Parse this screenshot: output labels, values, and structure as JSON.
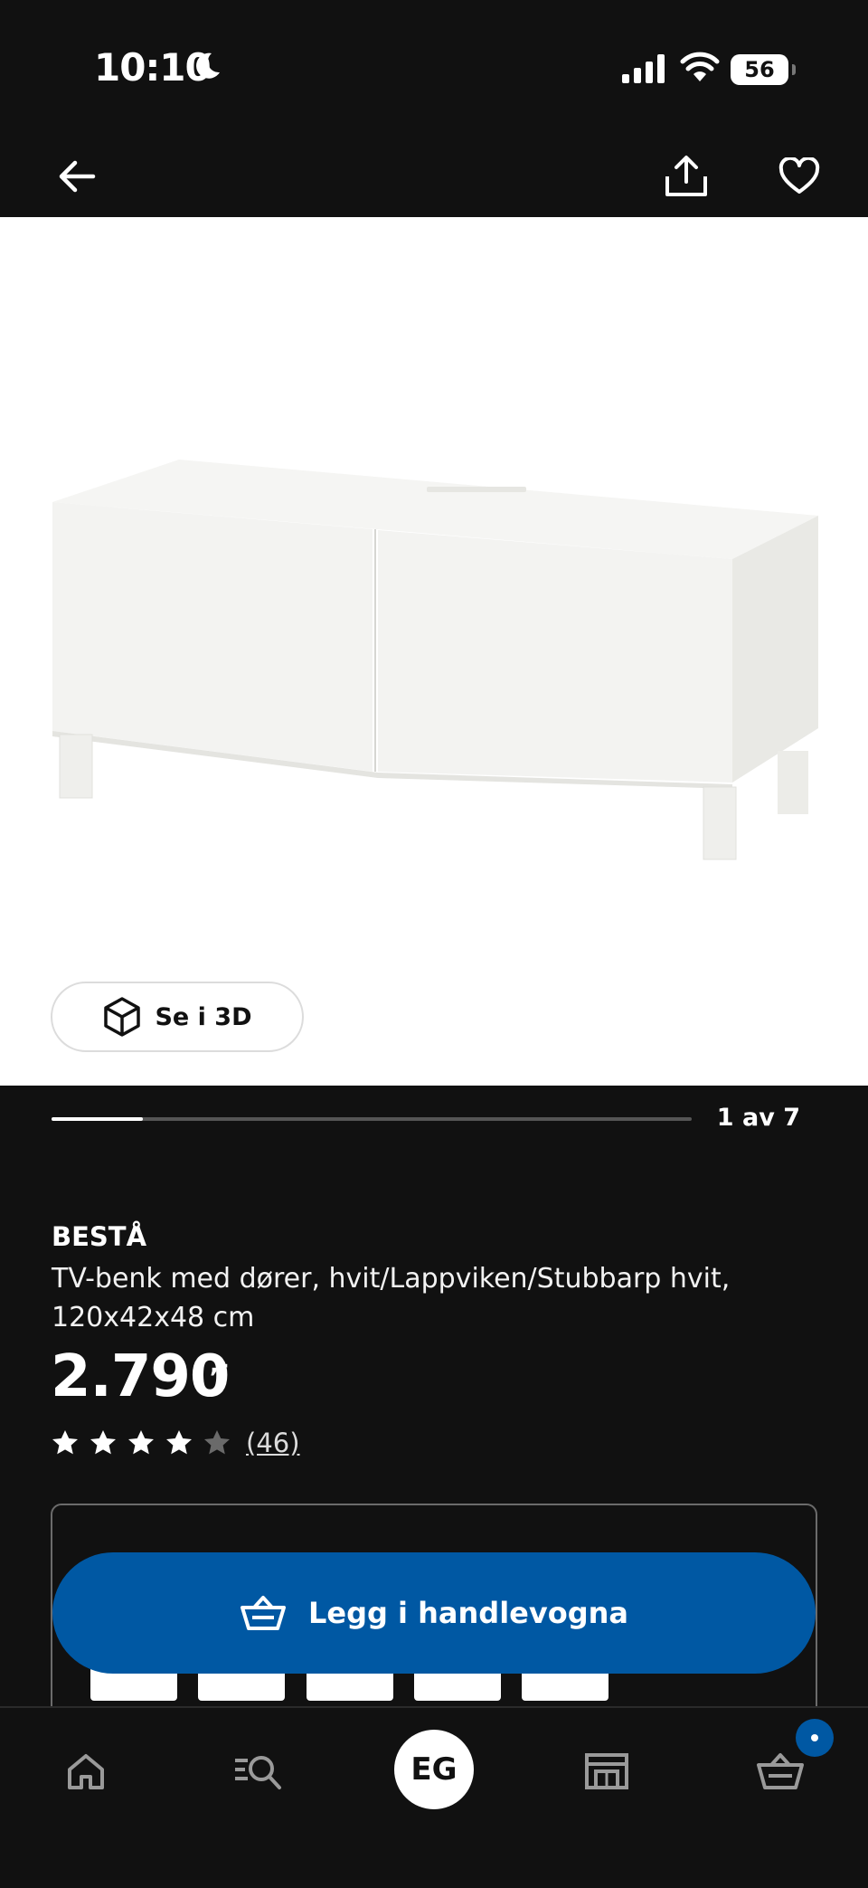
{
  "status_bar": {
    "time": "10:10",
    "battery": "56",
    "icons": [
      "moon-icon",
      "signal-icon",
      "wifi-icon",
      "battery-icon"
    ]
  },
  "top_nav": {
    "icons": [
      "back-arrow-icon",
      "share-icon",
      "heart-icon"
    ]
  },
  "gallery": {
    "view_3d_label": "Se i 3D",
    "counter": "1 av 7",
    "progress": 0.143
  },
  "product": {
    "brand": "BESTÅ",
    "description": "TV-benk med dører, hvit/Lappviken/Stubbarp hvit, 120x42x48 cm",
    "price": "2.790",
    "price_suffix": ",-",
    "rating": 4,
    "rating_max": 5,
    "review_count": "(46)"
  },
  "cta": {
    "label": "Legg i handlevogna"
  },
  "bottom_nav": {
    "avatar_initials": "EG",
    "icons": [
      "home-icon",
      "search-icon",
      "store-icon",
      "cart-icon"
    ]
  },
  "colors": {
    "background": "#111111",
    "accent": "#0058a3",
    "text": "#ffffff"
  }
}
